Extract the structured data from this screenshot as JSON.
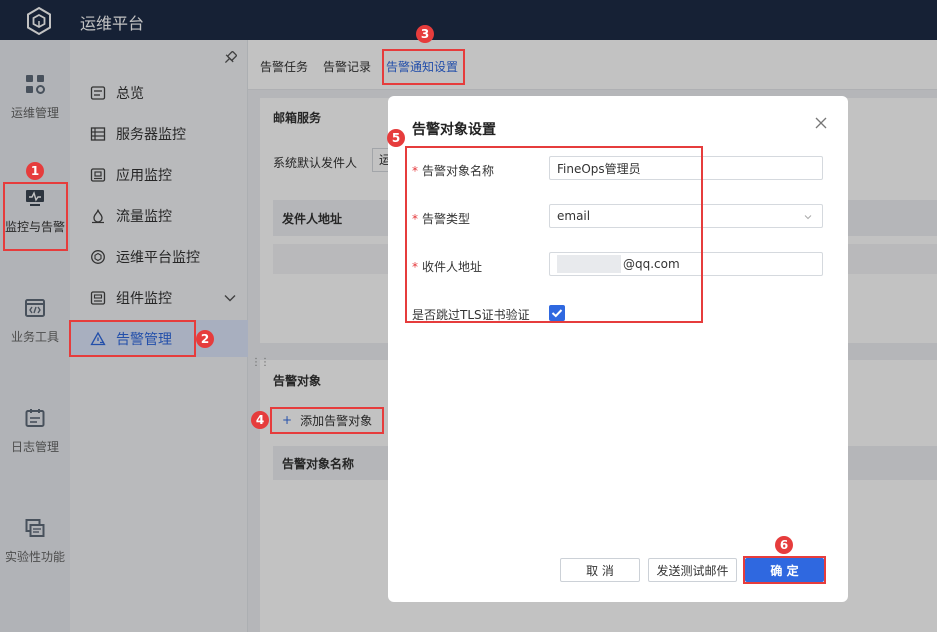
{
  "app": {
    "title": "运维平台"
  },
  "nav_rail": [
    {
      "label": "运维管理",
      "icon": "grid-icon"
    },
    {
      "label": "监控与告警",
      "icon": "monitor-icon"
    },
    {
      "label": "业务工具",
      "icon": "code-window-icon"
    },
    {
      "label": "日志管理",
      "icon": "calendar-icon"
    },
    {
      "label": "实验性功能",
      "icon": "layers-icon"
    }
  ],
  "subnav": [
    {
      "label": "总览",
      "icon": "overview-icon"
    },
    {
      "label": "服务器监控",
      "icon": "server-icon"
    },
    {
      "label": "应用监控",
      "icon": "app-icon"
    },
    {
      "label": "流量监控",
      "icon": "flow-icon"
    },
    {
      "label": "运维平台监控",
      "icon": "platform-icon"
    },
    {
      "label": "组件监控",
      "icon": "component-icon"
    },
    {
      "label": "告警管理",
      "icon": "alert-icon"
    }
  ],
  "tabs": [
    "告警任务",
    "告警记录",
    "告警通知设置"
  ],
  "mail_card": {
    "title": "邮箱服务",
    "default_sender_label": "系统默认发件人",
    "default_sender_value_partial": "运",
    "table_header": "发件人地址"
  },
  "target_card": {
    "title": "告警对象",
    "add_button": "添加告警对象",
    "add_icon": "+",
    "table_header": "告警对象名称"
  },
  "modal": {
    "title": "告警对象设置",
    "fields": {
      "name": {
        "label": "告警对象名称",
        "value": "FineOps管理员"
      },
      "type": {
        "label": "告警类型",
        "value": "email"
      },
      "address": {
        "label": "收件人地址",
        "value_suffix": "@qq.com"
      },
      "skip_tls": {
        "label": "是否跳过TLS证书验证",
        "checked": true
      }
    },
    "required_mark": "*",
    "buttons": {
      "cancel": "取 消",
      "send_test": "发送测试邮件",
      "confirm": "确 定"
    }
  },
  "annotations": [
    "1",
    "2",
    "3",
    "4",
    "5",
    "6"
  ],
  "colors": {
    "topbar": "#1e2c46",
    "accent": "#2f68e0",
    "highlight": "#e63c3c"
  }
}
